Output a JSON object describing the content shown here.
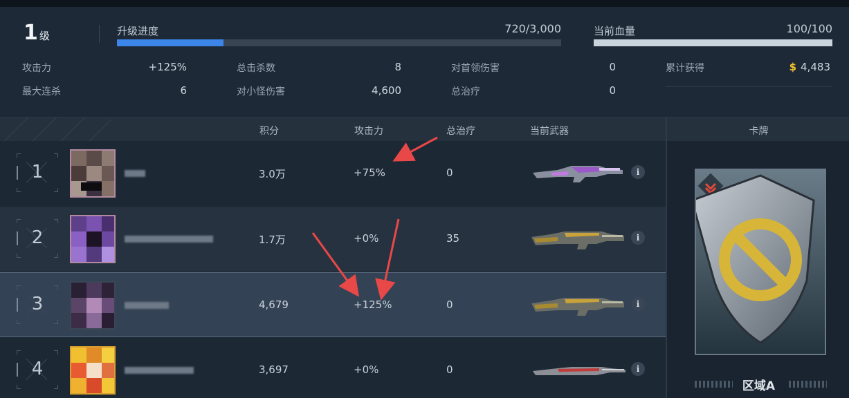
{
  "header": {
    "level": "1",
    "level_unit": "级",
    "xp": {
      "label": "升级进度",
      "value": "720/3,000",
      "progress": 0.24
    },
    "hp": {
      "label": "当前血量",
      "value": "100/100",
      "progress": 1.0
    },
    "stats": [
      {
        "label": "攻击力",
        "value": "+125%"
      },
      {
        "label": "总击杀数",
        "value": "8"
      },
      {
        "label": "对首领伤害",
        "value": "0"
      },
      {
        "label": "累计获得",
        "value": "4,483",
        "icon": "dollar-icon"
      },
      {
        "label": "最大连杀",
        "value": "6"
      },
      {
        "label": "对小怪伤害",
        "value": "4,600"
      },
      {
        "label": "总治疗",
        "value": "0"
      }
    ]
  },
  "table": {
    "columns": [
      "积分",
      "攻击力",
      "总治疗",
      "当前武器"
    ],
    "rows": [
      {
        "rank": "1",
        "score": "3.0万",
        "attack": "+75%",
        "heal": "0",
        "weapon": "purple-rifle-icon"
      },
      {
        "rank": "2",
        "score": "1.7万",
        "attack": "+0%",
        "heal": "35",
        "weapon": "gold-rifle-icon"
      },
      {
        "rank": "3",
        "score": "4,679",
        "attack": "+125%",
        "heal": "0",
        "weapon": "gold-rifle-icon"
      },
      {
        "rank": "4",
        "score": "3,697",
        "attack": "+0%",
        "heal": "0",
        "weapon": "red-rifle-icon"
      }
    ],
    "info_glyph": "i"
  },
  "card": {
    "title": "卡牌",
    "name": "区域A",
    "icon": "prohibited-shield-icon"
  },
  "colors": {
    "xp_fill": "#3b86e8",
    "hp_fill": "#c9d3dc",
    "coin": "#f0c02e",
    "annotation_arrow": "#e84848"
  }
}
